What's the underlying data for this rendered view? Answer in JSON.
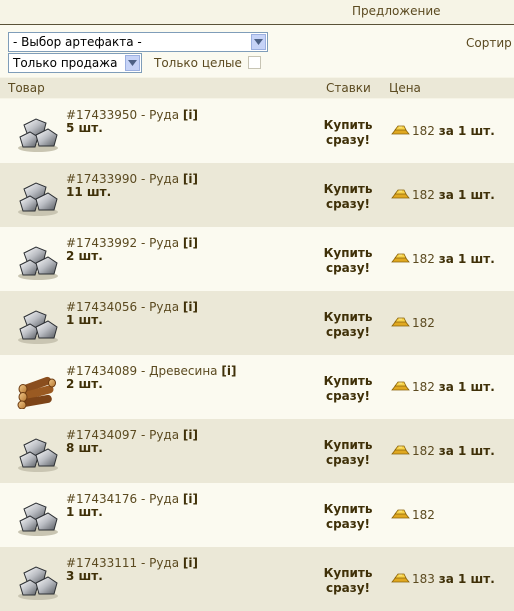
{
  "header": {
    "offer_link": "Предложение"
  },
  "filters": {
    "artifact_select": "- Выбор артефакта -",
    "sale_select": "Только продажа",
    "only_whole_label": "Только целые",
    "sort_label": "Сортир"
  },
  "columns": {
    "item": "Товар",
    "bids": "Ставки",
    "price": "Цена"
  },
  "buy_now_label": [
    "Купить",
    "сразу!"
  ],
  "rows": [
    {
      "lot": "#17433950 - Руда",
      "info": "[i]",
      "qty": "5 шт.",
      "price": "182",
      "per": "за 1 шт.",
      "icon": "ore-icon"
    },
    {
      "lot": "#17433990 - Руда",
      "info": "[i]",
      "qty": "11 шт.",
      "price": "182",
      "per": "за 1 шт.",
      "icon": "ore-icon"
    },
    {
      "lot": "#17433992 - Руда",
      "info": "[i]",
      "qty": "2 шт.",
      "price": "182",
      "per": "за 1 шт.",
      "icon": "ore-icon"
    },
    {
      "lot": "#17434056 - Руда",
      "info": "[i]",
      "qty": "1 шт.",
      "price": "182",
      "per": "",
      "icon": "ore-icon"
    },
    {
      "lot": "#17434089 - Древесина",
      "info": "[i]",
      "qty": "2 шт.",
      "price": "182",
      "per": "за 1 шт.",
      "icon": "wood-icon"
    },
    {
      "lot": "#17434097 - Руда",
      "info": "[i]",
      "qty": "8 шт.",
      "price": "182",
      "per": "за 1 шт.",
      "icon": "ore-icon"
    },
    {
      "lot": "#17434176 - Руда",
      "info": "[i]",
      "qty": "1 шт.",
      "price": "182",
      "per": "",
      "icon": "ore-icon"
    },
    {
      "lot": "#17433111 - Руда",
      "info": "[i]",
      "qty": "3 шт.",
      "price": "183",
      "per": "за 1 шт.",
      "icon": "ore-icon"
    }
  ],
  "colors": {
    "background": "#f6f4e6",
    "row_alt": "#ebe8d7",
    "text": "#5b4a20",
    "gold": "#e8b923"
  }
}
